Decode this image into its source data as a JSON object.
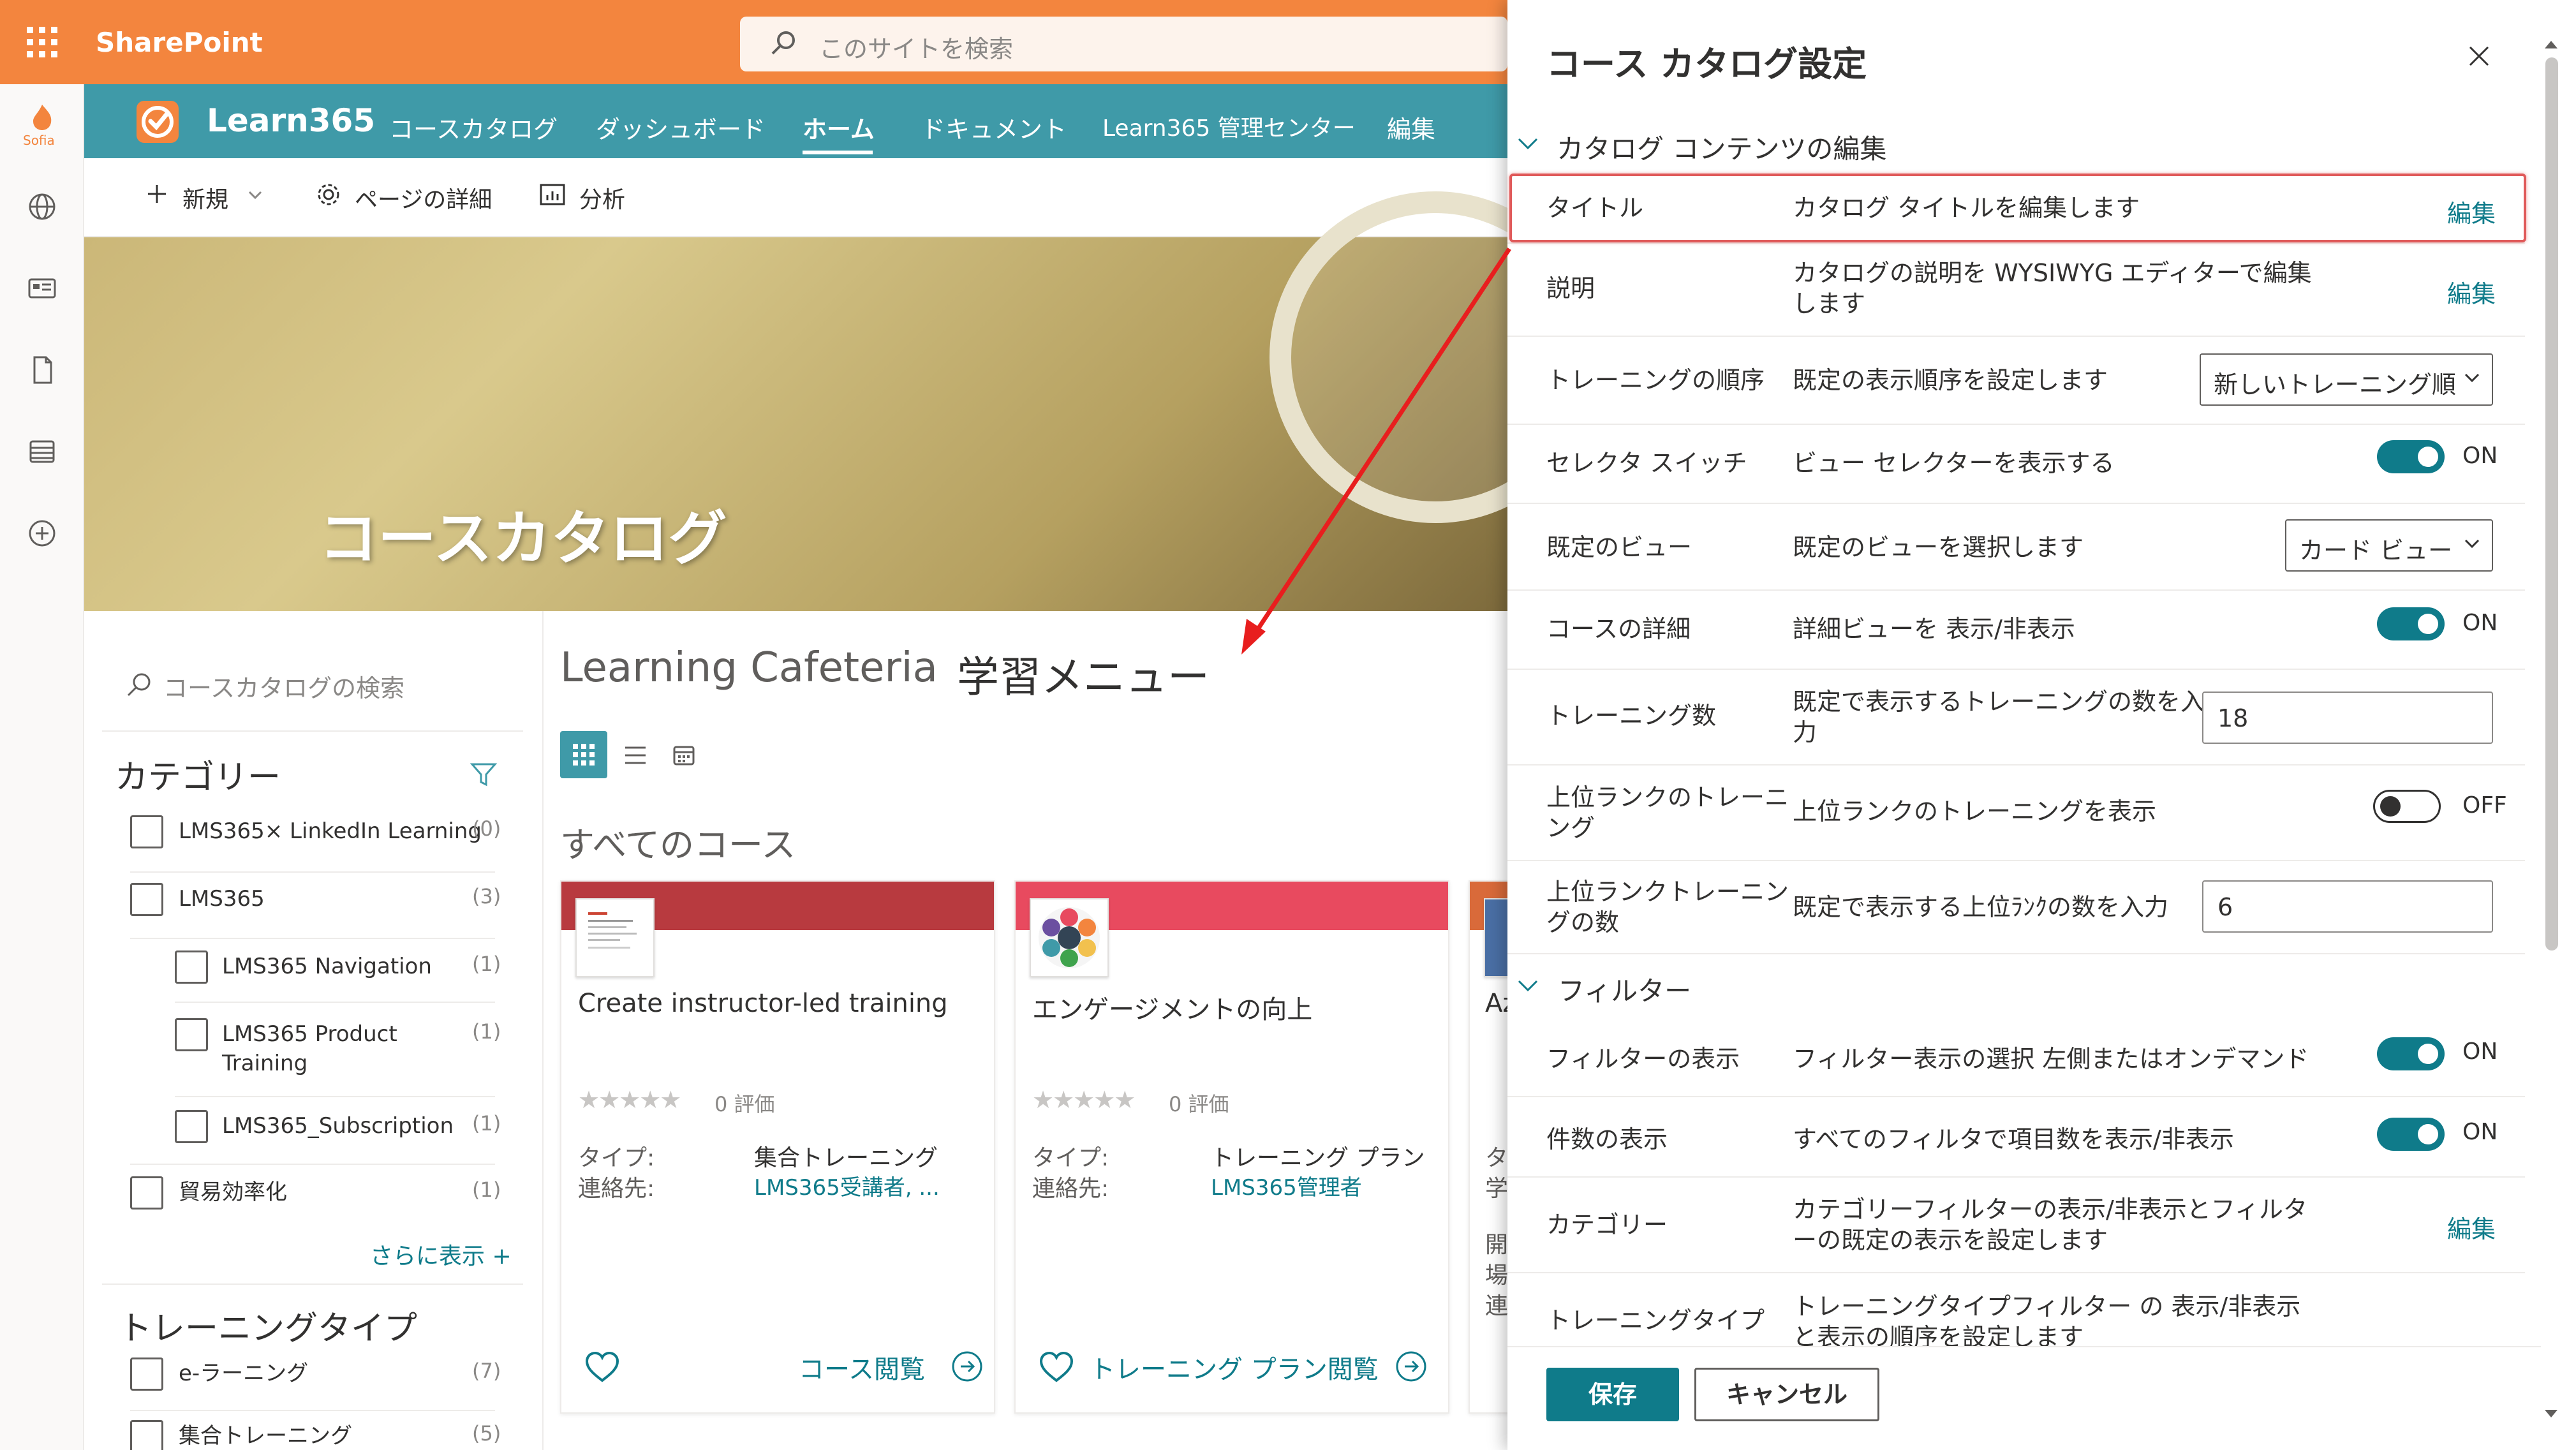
{
  "suite": {
    "brand": "SharePoint",
    "search_placeholder": "このサイトを検索"
  },
  "rail": {
    "logo_text": "Sofia",
    "icons": [
      "globe-icon",
      "news-icon",
      "document-icon",
      "list-icon",
      "add-icon"
    ]
  },
  "site": {
    "name": "Learn365",
    "nav": [
      "コースカタログ",
      "ダッシュボード",
      "ホーム",
      "ドキュメント",
      "Learn365 管理センター",
      "編集"
    ],
    "active_nav": "ホーム"
  },
  "commandbar": {
    "new": "新規",
    "page_details": "ページの詳細",
    "analytics": "分析"
  },
  "hero": {
    "title": "コースカタログ"
  },
  "filters": {
    "search_placeholder": "コースカタログの検索",
    "category_heading": "カテゴリー",
    "categories": [
      {
        "label": "LMS365× LinkedIn Learning",
        "count": "(0)"
      },
      {
        "label": "LMS365",
        "count": "(3)"
      },
      {
        "label": "LMS365 Navigation",
        "count": "(1)"
      },
      {
        "label_line1": "LMS365 Product",
        "label_line2": "Training",
        "count": "(1)"
      },
      {
        "label": "LMS365_Subscription",
        "count": "(1)"
      },
      {
        "label": "貿易効率化",
        "count": "(1)"
      }
    ],
    "show_more": "さらに表示 +",
    "training_type_heading": "トレーニングタイプ",
    "training_types": [
      {
        "label": "e-ラーニング",
        "count": "(7)"
      },
      {
        "label": "集合トレーニング",
        "count": "(5)"
      }
    ]
  },
  "main": {
    "title": "Learning Cafeteria",
    "subtitle": "学習メニュー",
    "all_courses": "すべてのコース",
    "cards": [
      {
        "band": "#b83a3f",
        "title": "Create instructor-led training",
        "stars": "★★★★★",
        "rating": "0 評価",
        "type_key": "タイプ:",
        "type_val": "集合トレーニング",
        "contact_key": "連絡先:",
        "contact_val": "LMS365受講者, ...",
        "action": "コース閲覧"
      },
      {
        "band": "#e84a5f",
        "title": "エンゲージメントの向上",
        "stars": "★★★★★",
        "rating": "0 評価",
        "type_key": "タイプ:",
        "type_val": "トレーニング プラン",
        "contact_key": "連絡先:",
        "contact_val": "LMS365管理者",
        "action": "トレーニング プラン閲覧"
      },
      {
        "band": "#d96a3a",
        "title": "Az",
        "partial_lines": [
          "タ",
          "学",
          "開",
          "場",
          "連"
        ]
      }
    ]
  },
  "panel": {
    "title": "コース カタログ設定",
    "section_content": "カタログ コンテンツの編集",
    "rows": [
      {
        "label": "タイトル",
        "desc": "カタログ タイトルを編集します",
        "link": "編集"
      },
      {
        "label": "説明",
        "desc1": "カタログの説明を WYSIWYG エディターで編集",
        "desc2": "します",
        "link": "編集"
      },
      {
        "label": "トレーニングの順序",
        "desc": "既定の表示順序を設定します",
        "select": "新しいトレーニング順"
      },
      {
        "label": "セレクタ スイッチ",
        "desc": "ビュー セレクターを表示する",
        "toggle": "ON"
      },
      {
        "label": "既定のビュー",
        "desc": "既定のビューを選択します",
        "select": "カード ビュー"
      },
      {
        "label": "コースの詳細",
        "desc": "詳細ビューを 表示/非表示",
        "toggle": "ON"
      },
      {
        "label": "トレーニング数",
        "desc1": "既定で表示するトレーニングの数を入",
        "desc2": "力",
        "value": "18"
      },
      {
        "label1": "上位ランクのトレーニ",
        "label2": "ング",
        "desc": "上位ランクのトレーニングを表示",
        "toggle": "OFF"
      },
      {
        "label1": "上位ランクトレーニン",
        "label2": "グの数",
        "desc": "既定で表示する上位ﾗﾝｸの数を入力",
        "value": "6"
      }
    ],
    "section_filter": "フィルター",
    "filter_rows": [
      {
        "label": "フィルターの表示",
        "desc": "フィルター表示の選択 左側またはオンデマンド",
        "toggle": "ON"
      },
      {
        "label": "件数の表示",
        "desc": "すべてのフィルタで項目数を表示/非表示",
        "toggle": "ON"
      },
      {
        "label": "カテゴリー",
        "desc1": "カテゴリーフィルターの表示/非表示とフィルタ",
        "desc2": "ーの既定の表示を設定します",
        "link": "編集"
      },
      {
        "label": "トレーニングタイプ",
        "desc1": "トレーニングタイプフィルター の 表示/非表示",
        "desc2": "と表示の順序を設定します"
      }
    ],
    "save": "保存",
    "cancel": "キャンセル"
  },
  "colors": {
    "suite_orange": "#f3853e",
    "site_teal": "#3f9aa8",
    "accent": "#0f7b8a",
    "highlight_red": "#e05a5a",
    "toggle_on": "#0f7b8a"
  }
}
